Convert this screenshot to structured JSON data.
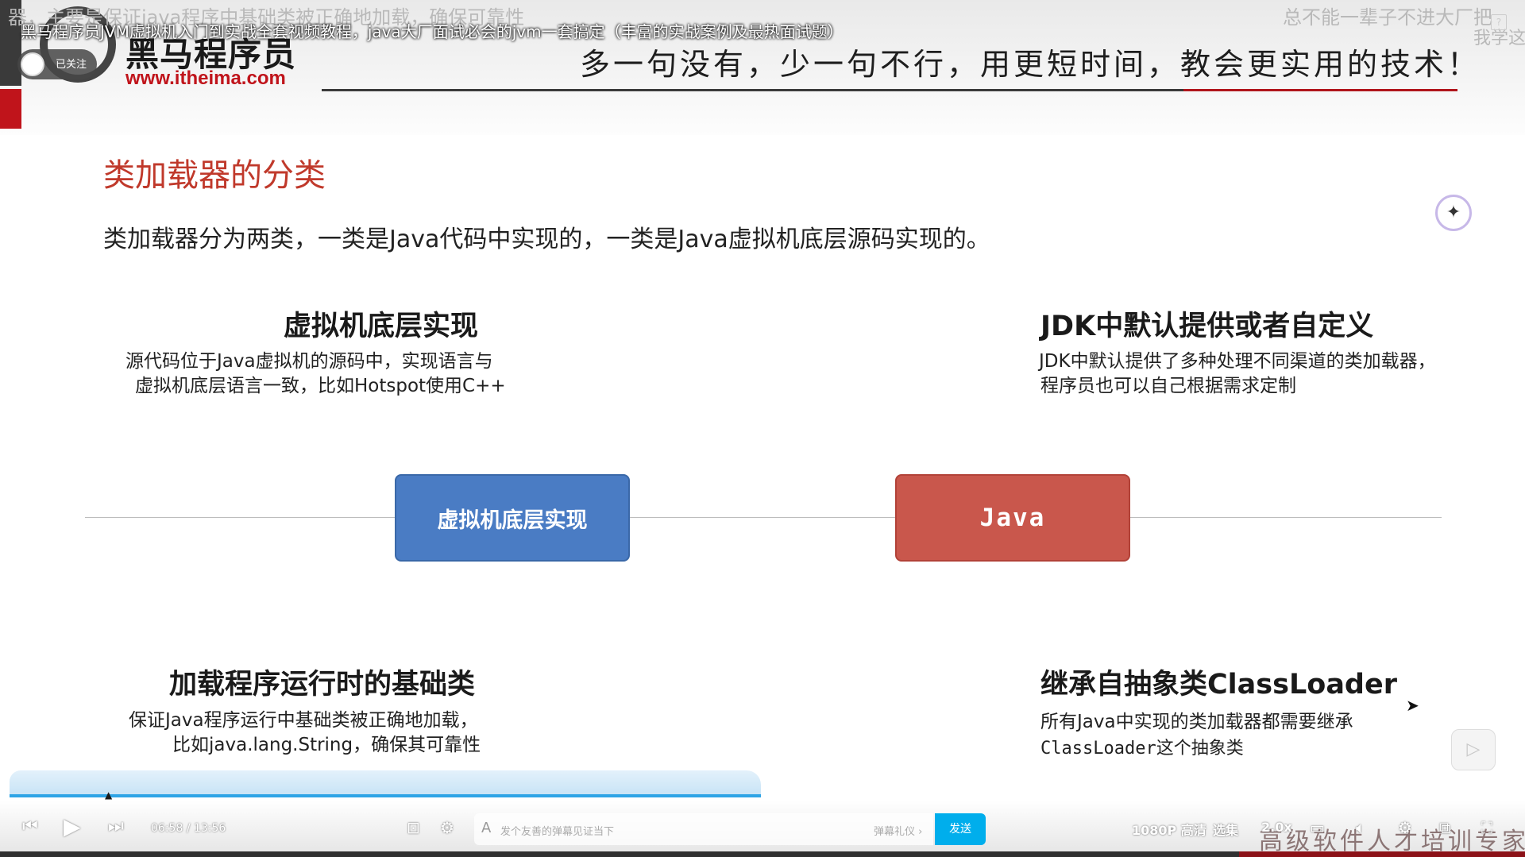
{
  "overlay": {
    "danmaku_left": "器，主要是保证java程序中基础类被正确地加载，确保可靠性",
    "video_title": "黑马程序员JVM虚拟机入门到实战全套视频教程，java大厂面试必会的jvm一套搞定（丰富的实战案例及最热面试题）",
    "danmaku_right": "总不能一辈子不进大厂把",
    "danmaku_right2": "我学这",
    "follow_label": "已关注",
    "help_glyph": "?"
  },
  "header": {
    "brand_name": "黑马程序员",
    "brand_url": "www.itheima.com",
    "slogan": "多一句没有，少一句不行，用更短时间，教会更实用的技术！"
  },
  "slide": {
    "section_title": "类加载器的分类",
    "intro": "类加载器分为两类，一类是Java代码中实现的，一类是Java虚拟机底层源码实现的。",
    "top_left": {
      "title": "虚拟机底层实现",
      "line1": "源代码位于Java虚拟机的源码中，实现语言与",
      "line2": "虚拟机底层语言一致，比如Hotspot使用C++"
    },
    "top_right": {
      "title": "JDK中默认提供或者自定义",
      "line1": "JDK中默认提供了多种处理不同渠道的类加载器，",
      "line2": "程序员也可以自己根据需求定制"
    },
    "box_left": "虚拟机底层实现",
    "box_right": "Java",
    "bottom_left": {
      "title": "加载程序运行时的基础类",
      "line1": "保证Java程序运行中基础类被正确地加载，",
      "line2": "比如java.lang.String，确保其可靠性"
    },
    "bottom_right": {
      "title": "继承自抽象类ClassLoader",
      "line1": "所有Java中实现的类加载器都需要继承",
      "line2": "ClassLoader这个抽象类"
    }
  },
  "player": {
    "progress_fraction": 0.508,
    "current_time": "06:58",
    "separator": "/",
    "duration": "13:56",
    "danmaku_placeholder": "发个友善的弹幕见证当下",
    "danmaku_etiquette": "弹幕礼仪 ›",
    "send_label": "发送",
    "quality": "1080P 高清",
    "episodes": "选集",
    "speed": "2.0x"
  },
  "footer": {
    "slogan": "高级软件人才培训专家"
  },
  "icons": {
    "prev": "prev-icon",
    "play": "play-icon",
    "next": "next-icon",
    "subtitle": "subtitle-icon",
    "volume": "volume-icon",
    "settings": "gear-icon",
    "pip": "pip-icon",
    "fullscreen": "fullscreen-icon"
  },
  "colors": {
    "accent_red": "#c0392b",
    "box_blue": "#4a7cc4",
    "box_red": "#c9574c",
    "progress_blue": "#2ea4e6",
    "send_blue": "#00aeec"
  }
}
